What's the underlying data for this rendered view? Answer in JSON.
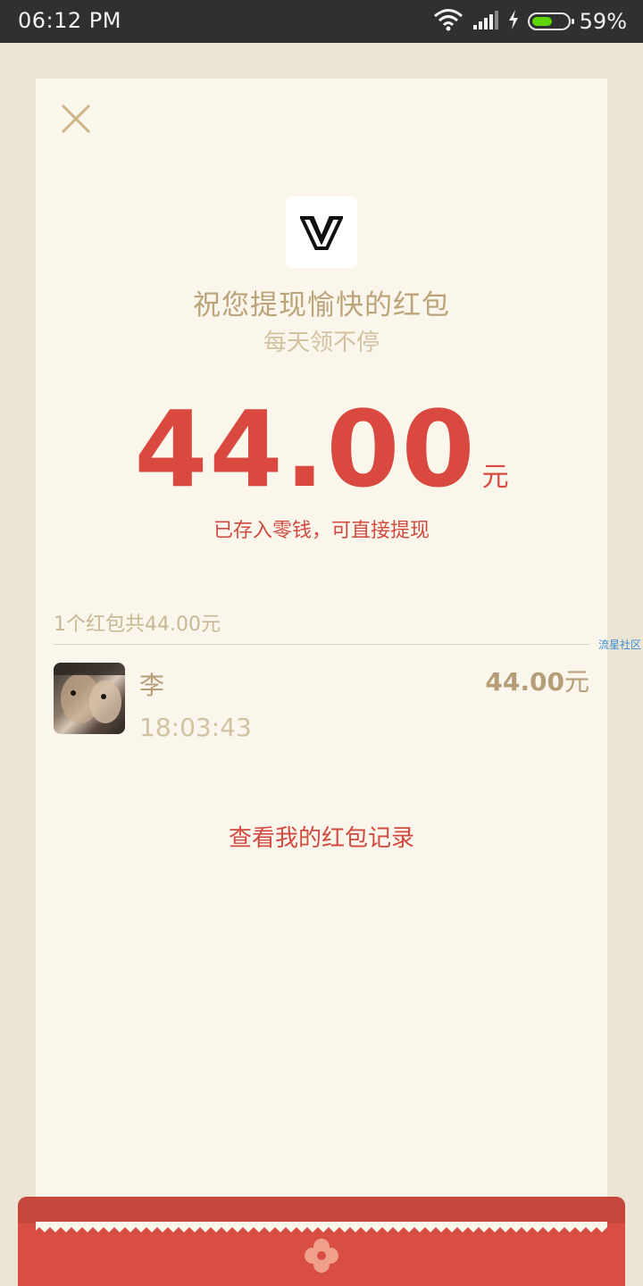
{
  "status_bar": {
    "time": "06:12 PM",
    "battery_percent": "59%",
    "battery_level": 0.59,
    "icons": [
      "wifi-icon",
      "signal-icon",
      "charging-icon",
      "battery-icon"
    ]
  },
  "card": {
    "close_icon": "close-icon",
    "logo": "W",
    "sender_title": "祝您提现愉快的红包",
    "sender_subtitle": "每天领不停",
    "amount": "44.00",
    "amount_unit": "元",
    "amount_note": "已存入零钱，可直接提现",
    "summary": "1个红包共44.00元",
    "receivers": [
      {
        "name": "李",
        "time": "18:03:43",
        "amount": "44.00",
        "unit": "元"
      }
    ],
    "records_link": "查看我的红包记录",
    "watermark": "流星社区"
  },
  "colors": {
    "accent_red": "#d9493f",
    "gold": "#bba37a",
    "card_bg": "#faf6ec",
    "page_bg": "#ede5d3"
  }
}
